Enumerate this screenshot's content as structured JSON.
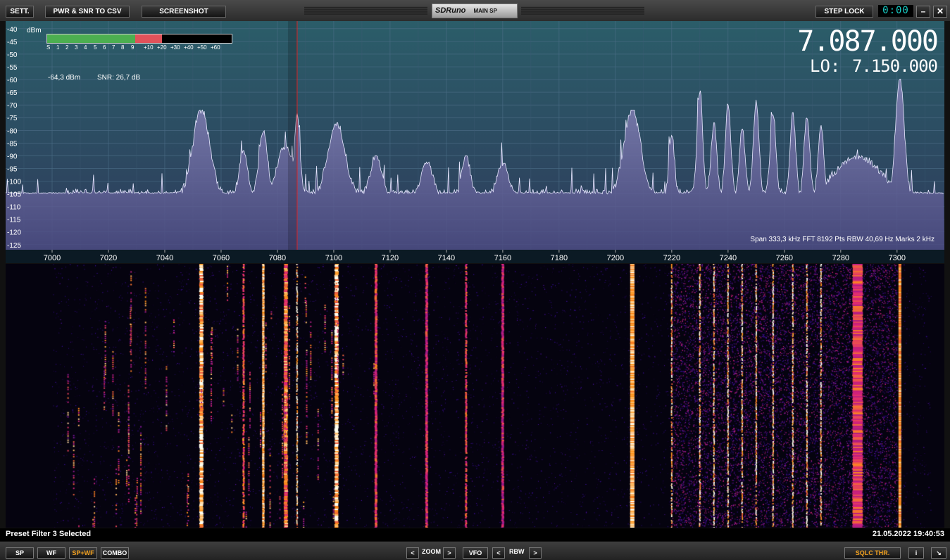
{
  "toolbar": {
    "sett": "SETT.",
    "pwr_snr": "PWR & SNR TO CSV",
    "screenshot": "SCREENSHOT",
    "logo_brand": "SDRuno",
    "logo_sub": "MAIN SP",
    "step_lock": "STEP LOCK",
    "clock": "0:00",
    "minimize": "–",
    "close": "✕"
  },
  "spectrum": {
    "dbm_unit": "dBm",
    "power_readout": "-64,3 dBm",
    "snr_readout": "SNR: 26,7 dB",
    "vfo_frequency": "7.087.000",
    "lo_label": "LO:",
    "lo_frequency": "7.150.000",
    "info": "Span 333,3 kHz   FFT 8192 Pts   RBW 40,69 Hz   Marks 2 kHz",
    "meter_scale": [
      "S",
      "1",
      "2",
      "3",
      "4",
      "5",
      "6",
      "7",
      "8",
      "9",
      "+10",
      "+20",
      "+30",
      "+40",
      "+50",
      "+60"
    ],
    "meter_level_s_units": "S9+20"
  },
  "chart_data": {
    "type": "area",
    "xlabel": "",
    "ylabel": "dBm",
    "x_ticks": [
      7000,
      7020,
      7040,
      7060,
      7080,
      7100,
      7120,
      7140,
      7160,
      7180,
      7200,
      7220,
      7240,
      7260,
      7280,
      7300
    ],
    "y_ticks": [
      -40,
      -45,
      -50,
      -55,
      -60,
      -65,
      -70,
      -75,
      -80,
      -85,
      -90,
      -95,
      -100,
      -105,
      -110,
      -115,
      -120,
      -125
    ],
    "xlim": [
      6983.5,
      7316.8
    ],
    "ylim": [
      -127,
      -37
    ],
    "vfo_marker_khz": 7087,
    "grid": true,
    "noise_floor_dbm": -106,
    "peaks": [
      {
        "f": 7053,
        "level": -72,
        "width": 3
      },
      {
        "f": 7068,
        "level": -88,
        "width": 1.5
      },
      {
        "f": 7075,
        "level": -80,
        "width": 1.5
      },
      {
        "f": 7083,
        "level": -86,
        "width": 3
      },
      {
        "f": 7087,
        "level": -73,
        "width": 1
      },
      {
        "f": 7101,
        "level": -77,
        "width": 3
      },
      {
        "f": 7115,
        "level": -90,
        "width": 2
      },
      {
        "f": 7133,
        "level": -92,
        "width": 2
      },
      {
        "f": 7147,
        "level": -90,
        "width": 1.5
      },
      {
        "f": 7160,
        "level": -93,
        "width": 2
      },
      {
        "f": 7206,
        "level": -72,
        "width": 3
      },
      {
        "f": 7220,
        "level": -82,
        "width": 1
      },
      {
        "f": 7230,
        "level": -64,
        "width": 1
      },
      {
        "f": 7235,
        "level": -77,
        "width": 1
      },
      {
        "f": 7240,
        "level": -70,
        "width": 1
      },
      {
        "f": 7245,
        "level": -79,
        "width": 1
      },
      {
        "f": 7250,
        "level": -68,
        "width": 1
      },
      {
        "f": 7256,
        "level": -73,
        "width": 1
      },
      {
        "f": 7263,
        "level": -73,
        "width": 1
      },
      {
        "f": 7268,
        "level": -75,
        "width": 1
      },
      {
        "f": 7273,
        "level": -78,
        "width": 1
      },
      {
        "f": 7286,
        "level": -90,
        "width": 8
      },
      {
        "f": 7301,
        "level": -59,
        "width": 1.5
      }
    ]
  },
  "status": {
    "left": "Preset Filter 3 Selected",
    "right": "21.05.2022 19:40:53"
  },
  "bottom": {
    "sp": "SP",
    "wf": "WF",
    "spwf": "SP+WF",
    "combo": "COMBO",
    "zoom": "ZOOM",
    "vfo": "VFO",
    "rbw": "RBW",
    "lt": "<",
    "gt": ">",
    "sqlc": "SQLC THR.",
    "info": "i",
    "resize": "↘"
  },
  "colors": {
    "spectrum_bg_top": "#2b5d69",
    "spectrum_bg_bottom": "#2d3e5c",
    "spectrum_fill": "#6a6a9c",
    "vfo_marker": "#e02020",
    "orange_accent": "#f0a020"
  }
}
